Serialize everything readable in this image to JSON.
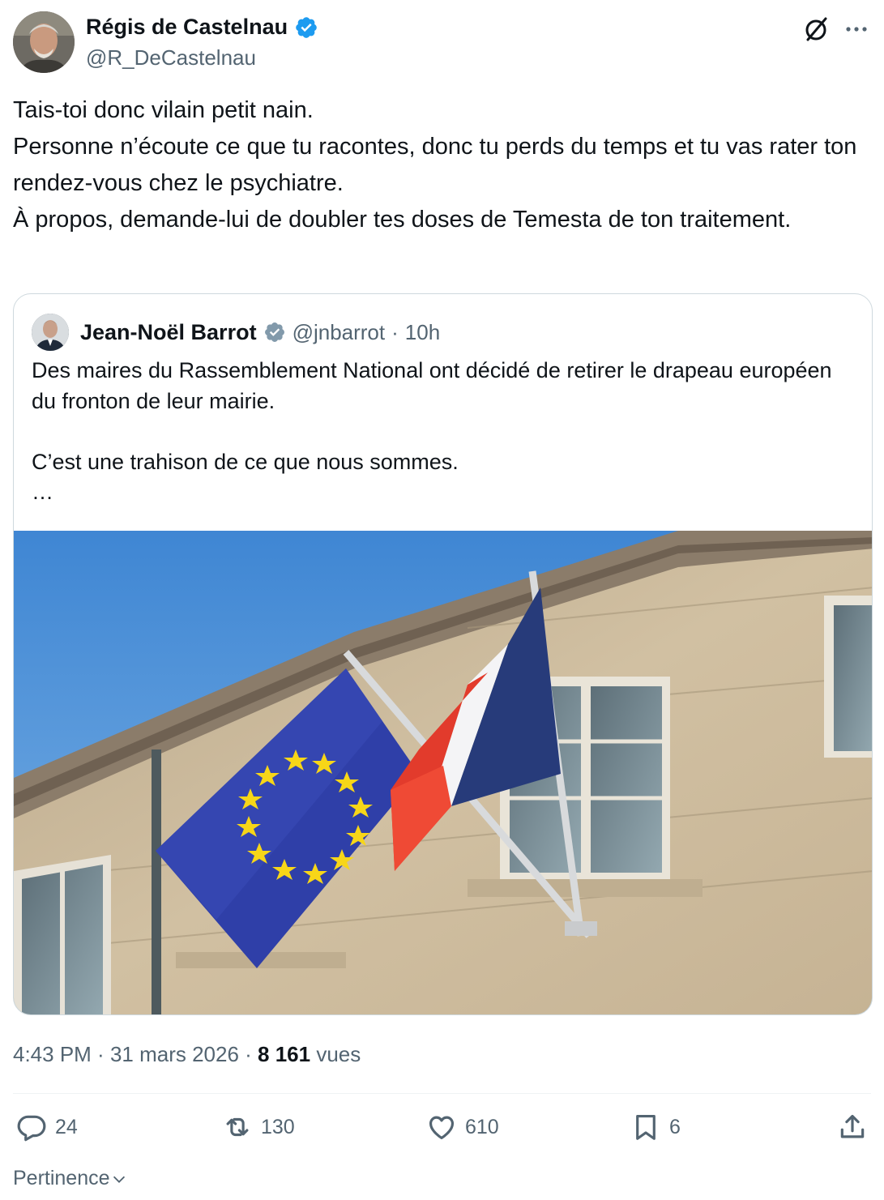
{
  "author": {
    "display_name": "Régis de Castelnau",
    "handle": "@R_DeCastelnau",
    "verified": true,
    "avatar_icon": "user-avatar"
  },
  "tweet": {
    "text": "Tais-toi donc vilain petit nain.\nPersonne n’écoute ce que tu racontes, donc tu perds du temps et tu vas rater ton rendez-vous chez le psychiatre.\nÀ propos, demande-lui de doubler tes doses de Temesta de ton traitement."
  },
  "quoted": {
    "display_name": "Jean-Noël Barrot",
    "handle": "@jnbarrot",
    "separator": "·",
    "time": "10h",
    "text": "Des maires du Rassemblement National ont décidé de retirer le drapeau européen du fronton de leur mairie.\n\nC’est une trahison de ce que nous sommes.\n…",
    "image_icon": "eu-and-french-flags-photo"
  },
  "meta": {
    "time": "4:43 PM",
    "sep1": " · ",
    "date": "31 mars 2026",
    "sep2": " · ",
    "views_count": "8 161",
    "views_label": " vues"
  },
  "actions": {
    "replies": "24",
    "reposts": "130",
    "likes": "610",
    "bookmarks": "6"
  },
  "sort": {
    "label": "Pertinence"
  },
  "colors": {
    "verified": "#1d9bf0",
    "secondary_text": "#536471",
    "border": "#cfd9de"
  }
}
